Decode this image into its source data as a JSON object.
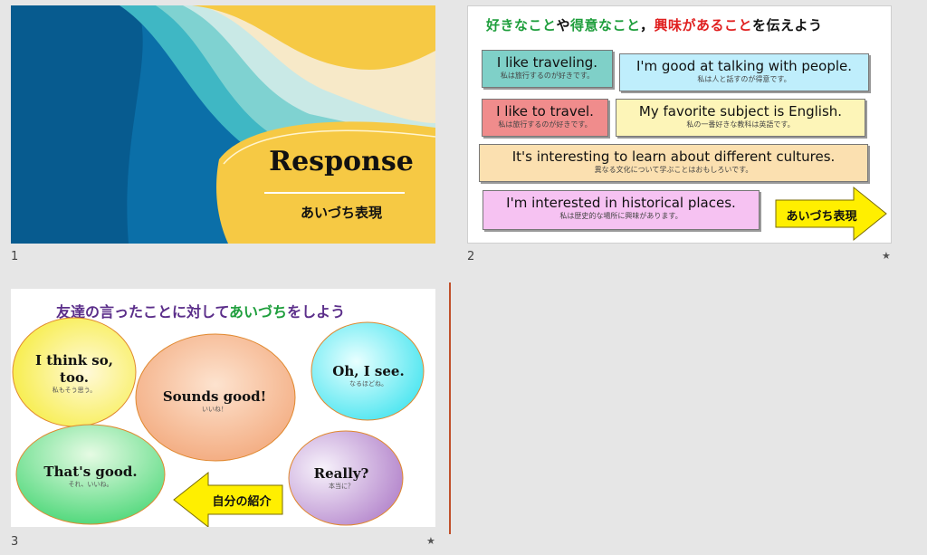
{
  "slides": [
    {
      "number": "1",
      "title": "Response",
      "subtitle": "あいづち表現"
    },
    {
      "number": "2",
      "title_parts": [
        "好きなこと",
        "や",
        "得意なこと",
        "，",
        "興味があること",
        "を伝えよう"
      ],
      "boxes": [
        {
          "en": "I like traveling.",
          "jp": "私は旅行するのが好きです。"
        },
        {
          "en": "I'm good at talking with people.",
          "jp": "私は人と話すのが得意です。"
        },
        {
          "en": "I like to travel.",
          "jp": "私は旅行するのが好きです。"
        },
        {
          "en": "My favorite subject is English.",
          "jp": "私の一番好きな教科は英語です。"
        },
        {
          "en": "It's interesting to learn about different cultures.",
          "jp": "異なる文化について学ぶことはおもしろいです。"
        },
        {
          "en": "I'm interested in historical places.",
          "jp": "私は歴史的な場所に興味があります。"
        }
      ],
      "arrow_label": "あいづち表現",
      "marker": "★"
    },
    {
      "number": "3",
      "title_a": "友達の言ったことに対して",
      "title_b": "あいづち",
      "title_c": "をしよう",
      "bubbles": [
        {
          "en": "I think so, too.",
          "jp": "私もそう思う。"
        },
        {
          "en": "Sounds good!",
          "jp": "いいね！"
        },
        {
          "en": "Oh, I see.",
          "jp": "なるほどね。"
        },
        {
          "en": "That's good.",
          "jp": "それ、いいね。"
        },
        {
          "en": "Really?",
          "jp": "本当に？"
        }
      ],
      "arrow_label": "自分の紹介",
      "marker": "★"
    }
  ],
  "colors": {
    "slide1_blue": "#0b6fa8",
    "slide1_yellow": "#f6c944",
    "green_text": "#1e9e3c",
    "red_text": "#e02020",
    "title3_purple": "#5b2e8a",
    "arrow_yellow": "#ffef00"
  }
}
